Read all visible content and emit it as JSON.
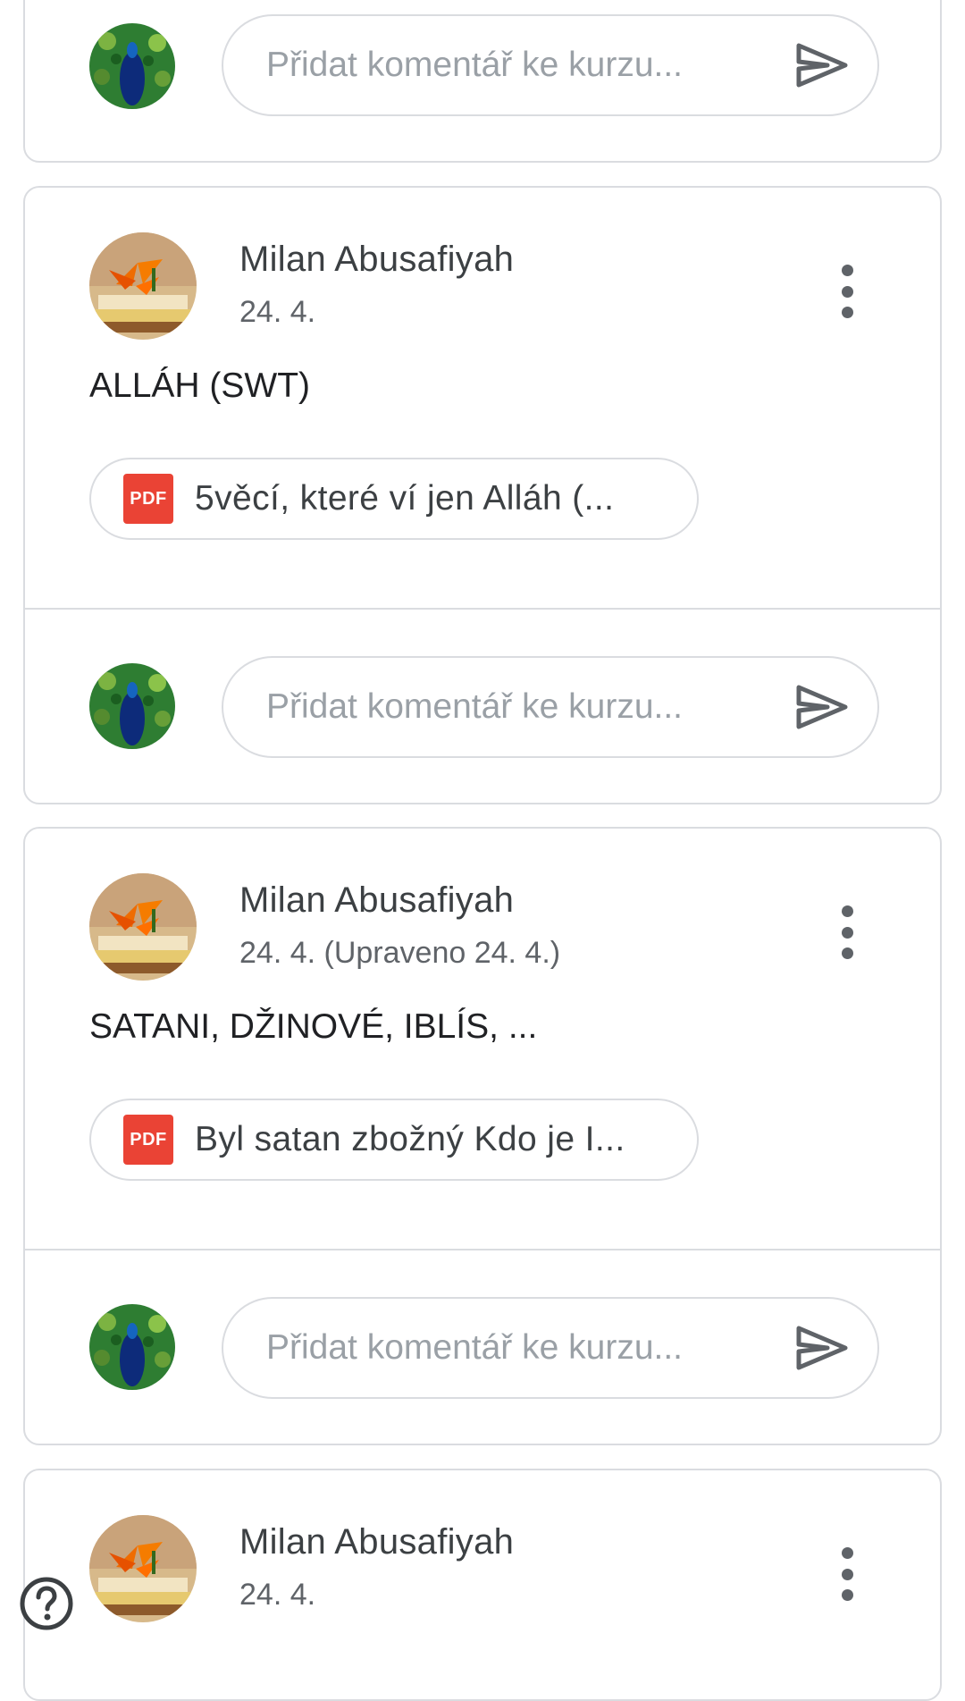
{
  "comment_placeholder": "Přidat komentář ke kurzu...",
  "posts": [
    {
      "author": "Milan Abusafiyah",
      "date": "24. 4.",
      "body": "ALLÁH (SWT)",
      "attachment": {
        "type_label": "PDF",
        "title": "5věcí, které ví jen Alláh (..."
      }
    },
    {
      "author": "Milan Abusafiyah",
      "date": "24. 4. (Upraveno 24. 4.)",
      "body": "SATANI, DŽINOVÉ, IBLÍS, ...",
      "attachment": {
        "type_label": "PDF",
        "title": "Byl satan zbožný Kdo je I..."
      }
    },
    {
      "author": "Milan Abusafiyah",
      "date": "24. 4."
    }
  ],
  "icons": {
    "send": "send-icon",
    "more": "more-vert-icon",
    "help": "help-icon",
    "pdf": "pdf-icon"
  },
  "colors": {
    "pdf_red": "#ea4335",
    "border": "#dadce0",
    "secondary_text": "#5f6368"
  }
}
